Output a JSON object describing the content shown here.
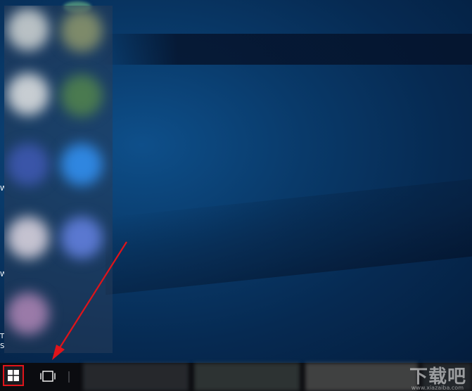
{
  "desktop": {
    "wallpaper": "Windows 10 hero blue",
    "icon_label_fragments": [
      "W",
      "W",
      "T",
      "S"
    ]
  },
  "start_menu": {
    "state": "open",
    "content": "blurred tiles"
  },
  "taskbar": {
    "start_button_icon": "windows-logo-icon",
    "task_view_icon": "task-view-icon",
    "highlight_color": "#e0141a"
  },
  "annotation": {
    "arrow_color": "#e0141a",
    "points_to": "start-button"
  },
  "watermark": {
    "text": "下载吧",
    "sub": "www.xiazaiba.com"
  }
}
